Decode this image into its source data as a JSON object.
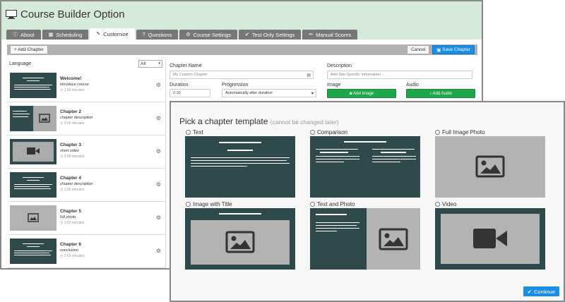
{
  "window": {
    "title": "Course Builder Option"
  },
  "tabs": [
    {
      "label": "About",
      "icon": "info-icon"
    },
    {
      "label": "Scheduling",
      "icon": "calendar-icon"
    },
    {
      "label": "Customize",
      "icon": "edit-icon",
      "active": true
    },
    {
      "label": "Questions",
      "icon": "question-icon"
    },
    {
      "label": "Course Settings",
      "icon": "gears-icon"
    },
    {
      "label": "Test Only Settings",
      "icon": "check-icon"
    },
    {
      "label": "Manual Scores",
      "icon": "pencil-icon"
    }
  ],
  "toolbar": {
    "add_chapter": "+ Add Chapter",
    "cancel": "Cancel",
    "save": "Save Chapter"
  },
  "sidebar": {
    "language_label": "Language",
    "language_value": "All",
    "chapters": [
      {
        "name": "Welcome!",
        "desc": "introduce course",
        "duration": "1:00 minutes"
      },
      {
        "name": "Chapter 2",
        "desc": "chapter description",
        "duration": "2:00 minutes"
      },
      {
        "name": "Chapter 3",
        "desc": "short video",
        "duration": "3:00 minutes"
      },
      {
        "name": "Chapter 4",
        "desc": "chapter description",
        "duration": "1:00 minutes"
      },
      {
        "name": "Chapter 5",
        "desc": "full photo",
        "duration": "1:00 minutes"
      },
      {
        "name": "Chapter 6",
        "desc": "conclusion",
        "duration": "3:00 minutes"
      }
    ]
  },
  "form": {
    "chapter_name_label": "Chapter Name",
    "chapter_name_placeholder": "My Custom Chapter",
    "description_label": "Description",
    "description_placeholder": "Add Site-Specific Information",
    "duration_label": "Duration",
    "duration_value": "0:30",
    "progression_label": "Progression",
    "progression_value": "Automatically after duration",
    "image_label": "Image",
    "add_image": "Add Image",
    "audio_label": "Audio",
    "add_audio": "Add Audio"
  },
  "modal": {
    "heading": "Pick a chapter template",
    "subheading": "(cannot be changed later)",
    "templates": [
      "Text",
      "Comparison",
      "Full Image Photo",
      "Image with Title",
      "Text and Photo",
      "Video"
    ],
    "continue": "Continue"
  },
  "colors": {
    "header_bg": "#d5ead9",
    "thumb_bg": "#2e4a4d",
    "primary": "#1a8ee6",
    "success": "#1fa84a"
  }
}
